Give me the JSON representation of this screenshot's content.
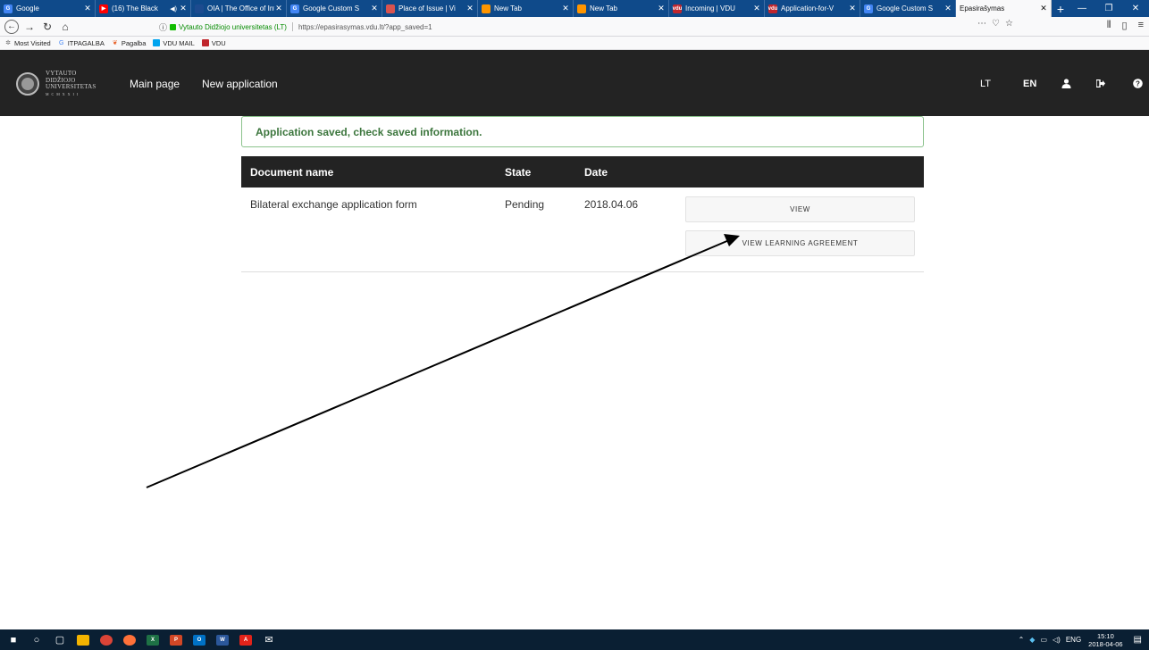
{
  "browser": {
    "tabs": [
      {
        "title": "Google",
        "favicon_color": "#4285f4",
        "favicon_glyph": "G",
        "active": false
      },
      {
        "title": "(16) The Black",
        "favicon_color": "#ff0000",
        "favicon_glyph": "▶",
        "active": false,
        "audio": true
      },
      {
        "title": "OIA | The Office of Int",
        "favicon_color": "#1d4b8f",
        "favicon_glyph": "",
        "active": false
      },
      {
        "title": "Google Custom S",
        "favicon_color": "#4285f4",
        "favicon_glyph": "G",
        "active": false
      },
      {
        "title": "Place of Issue | Vi",
        "favicon_color": "#d9534f",
        "favicon_glyph": "",
        "active": false
      },
      {
        "title": "New Tab",
        "favicon_color": "#ff9500",
        "favicon_glyph": "",
        "active": false
      },
      {
        "title": "New Tab",
        "favicon_color": "#ff9500",
        "favicon_glyph": "",
        "active": false
      },
      {
        "title": "Incoming | VDU",
        "favicon_color": "#c0262d",
        "favicon_glyph": "vdu",
        "active": false
      },
      {
        "title": "Application-for-V",
        "favicon_color": "#c0262d",
        "favicon_glyph": "vdu",
        "active": false
      },
      {
        "title": "Google Custom S",
        "favicon_color": "#4285f4",
        "favicon_glyph": "G",
        "active": false
      },
      {
        "title": "Epasirašymas",
        "favicon_color": "",
        "favicon_glyph": "",
        "active": true
      }
    ],
    "new_tab_glyph": "+",
    "url": {
      "site_identity": "Vytauto Didžiojo universitetas (LT)",
      "address": "https://epasirasymas.vdu.lt/?app_saved=1"
    },
    "bookmarks": [
      {
        "label": "Most Visited",
        "icon": "gear-icon",
        "color": "#666666",
        "glyph": "✲"
      },
      {
        "label": "ITPAGALBA",
        "icon": "google-icon",
        "color": "#4285f4",
        "glyph": "G"
      },
      {
        "label": "Pagalba",
        "icon": "pagalba-icon",
        "color": "#e8632a",
        "glyph": "❦"
      },
      {
        "label": "VDU MAIL",
        "icon": "windows-icon",
        "color": "#00a4ef",
        "glyph": ""
      },
      {
        "label": "VDU",
        "icon": "vdu-icon",
        "color": "#c0262d",
        "glyph": ""
      }
    ]
  },
  "site": {
    "logo_text": [
      "VYTAUTO",
      "DIDŽIOJO",
      "UNIVERSITETAS"
    ],
    "logo_motto": "M C M X X I I",
    "nav": {
      "main_page": "Main page",
      "new_application": "New application"
    },
    "lang": {
      "lt": "LT",
      "en": "EN"
    }
  },
  "content": {
    "alert": "Application saved, check saved information.",
    "table": {
      "headers": {
        "document_name": "Document name",
        "state": "State",
        "date": "Date"
      },
      "rows": [
        {
          "document_name": "Bilateral exchange application form",
          "state": "Pending",
          "date": "2018.04.06",
          "view_label": "VIEW",
          "learning_agreement_label": "VIEW LEARNING AGREEMENT"
        }
      ]
    }
  },
  "taskbar": {
    "apps": [
      {
        "name": "windows-start-icon",
        "color": "#ffffff",
        "glyph": "■"
      },
      {
        "name": "search-icon",
        "color": "#ffffff",
        "glyph": "○"
      },
      {
        "name": "task-view-icon",
        "color": "#ffffff",
        "glyph": "▢"
      },
      {
        "name": "file-explorer-icon",
        "color": "#f4b400",
        "glyph": ""
      },
      {
        "name": "chrome-icon",
        "color": "#db4437",
        "glyph": ""
      },
      {
        "name": "firefox-icon",
        "color": "#ff7139",
        "glyph": ""
      },
      {
        "name": "excel-icon",
        "color": "#1e7145",
        "glyph": "X"
      },
      {
        "name": "powerpoint-icon",
        "color": "#d24726",
        "glyph": "P"
      },
      {
        "name": "outlook-icon",
        "color": "#0072c6",
        "glyph": "O"
      },
      {
        "name": "word-icon",
        "color": "#2b579a",
        "glyph": "W"
      },
      {
        "name": "acrobat-icon",
        "color": "#e2231a",
        "glyph": "A"
      },
      {
        "name": "mail-icon",
        "color": "#ffffff",
        "glyph": "✉"
      }
    ],
    "language": "ENG",
    "time": "15:10",
    "date": "2018-04-06"
  },
  "colors": {
    "header_bg": "#232323",
    "alert_border": "#8bc28c",
    "alert_text": "#3c763d",
    "tabbar_bg": "#0f4a8a",
    "taskbar_bg": "#0a1f33"
  }
}
